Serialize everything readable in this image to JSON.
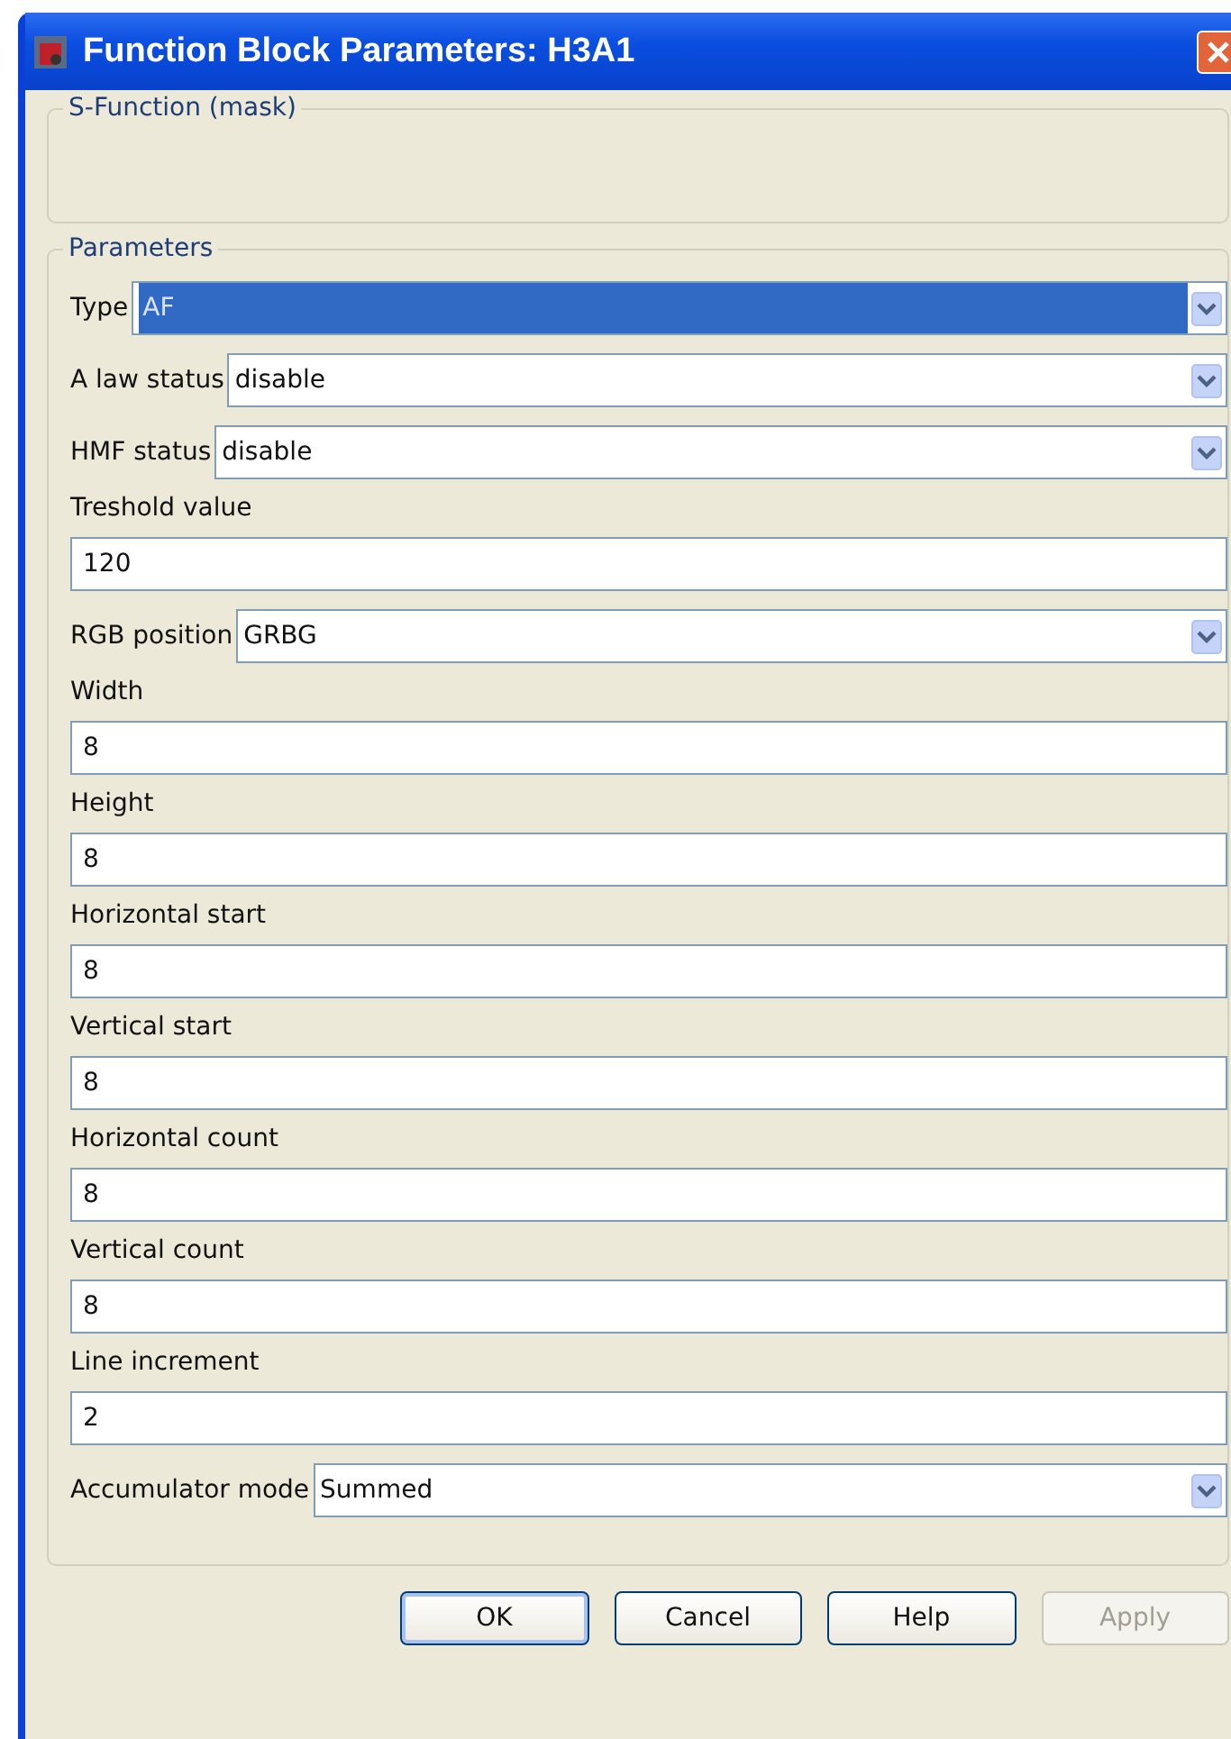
{
  "window": {
    "title": "Function Block Parameters: H3A1"
  },
  "description_group": {
    "title": "S-Function (mask)"
  },
  "parameters_group": {
    "title": "Parameters",
    "params": [
      {
        "kind": "dropdown",
        "label": "Type",
        "value": "AF",
        "selected": true
      },
      {
        "kind": "dropdown",
        "label": "A law status",
        "value": "disable",
        "selected": false
      },
      {
        "kind": "dropdown",
        "label": "HMF status",
        "value": "disable",
        "selected": false
      },
      {
        "kind": "text",
        "label": "Treshold value",
        "value": "120"
      },
      {
        "kind": "dropdown",
        "label": "RGB position",
        "value": "GRBG",
        "selected": false
      },
      {
        "kind": "text",
        "label": "Width",
        "value": "8"
      },
      {
        "kind": "text",
        "label": "Height",
        "value": "8"
      },
      {
        "kind": "text",
        "label": "Horizontal start",
        "value": "8"
      },
      {
        "kind": "text",
        "label": "Vertical start",
        "value": "8"
      },
      {
        "kind": "text",
        "label": "Horizontal count",
        "value": "8"
      },
      {
        "kind": "text",
        "label": "Vertical count",
        "value": "8"
      },
      {
        "kind": "text",
        "label": "Line increment",
        "value": "2"
      },
      {
        "kind": "dropdown",
        "label": "Accumulator mode",
        "value": "Summed",
        "selected": false
      }
    ]
  },
  "buttons": [
    {
      "label": "OK",
      "disabled": false,
      "default": true
    },
    {
      "label": "Cancel",
      "disabled": false,
      "default": false
    },
    {
      "label": "Help",
      "disabled": false,
      "default": false
    },
    {
      "label": "Apply",
      "disabled": true,
      "default": false
    }
  ]
}
